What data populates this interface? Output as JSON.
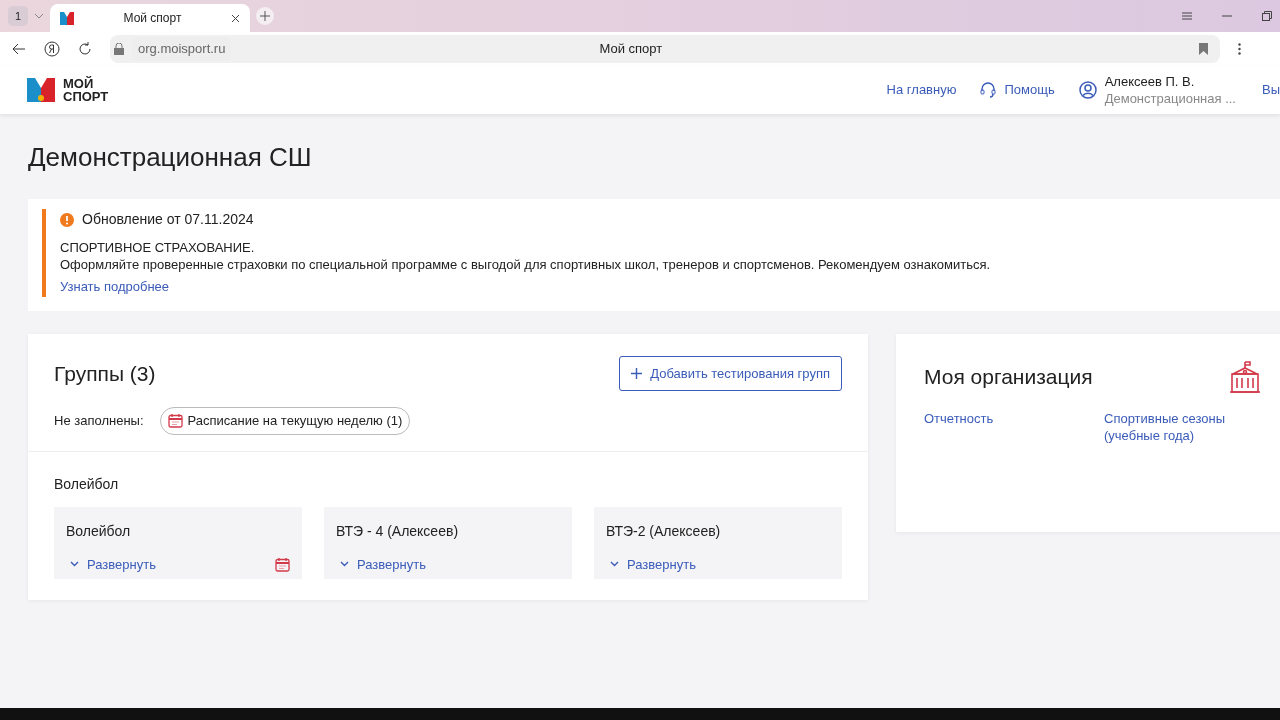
{
  "browser": {
    "tab_count": "1",
    "tab_title": "Мой спорт",
    "address": "org.moisport.ru",
    "page_title": "Мой спорт"
  },
  "header": {
    "logo_text": [
      "МОЙ",
      "СПОРТ"
    ],
    "links": [
      {
        "kind": "plain",
        "label": "На главную"
      },
      {
        "kind": "help",
        "label": "Помощь"
      }
    ],
    "user": {
      "name": "Алексеев П. В.",
      "org": "Демонстрационная ..."
    },
    "logout": "Вы"
  },
  "page_title": "Демонстрационная СШ",
  "notice": {
    "title": "Обновление от 07.11.2024",
    "heading": "СПОРТИВНОЕ СТРАХОВАНИЕ.",
    "text": "Оформляйте проверенные страховки по специальной программе с выгодой для спортивных школ, тренеров и спортсменов. Рекомендуем ознакомиться.",
    "link": "Узнать подробнее"
  },
  "groups": {
    "title": "Группы (3)",
    "add_button": "Добавить тестирования групп",
    "unfilled_label": "Не заполнены:",
    "unfilled_chip": "Расписание на текущую неделю (1)",
    "sport": "Волейбол",
    "cards": [
      {
        "name": "Волейбол",
        "expand": "Развернуть",
        "schedule_missing": true
      },
      {
        "name": "ВТЭ - 4 (Алексеев)",
        "expand": "Развернуть",
        "schedule_missing": false
      },
      {
        "name": "ВТЭ-2 (Алексеев)",
        "expand": "Развернуть",
        "schedule_missing": false
      }
    ]
  },
  "organization": {
    "title": "Моя организация",
    "links": [
      "Отчетность",
      "Спортивные сезоны (учебные года)"
    ]
  }
}
